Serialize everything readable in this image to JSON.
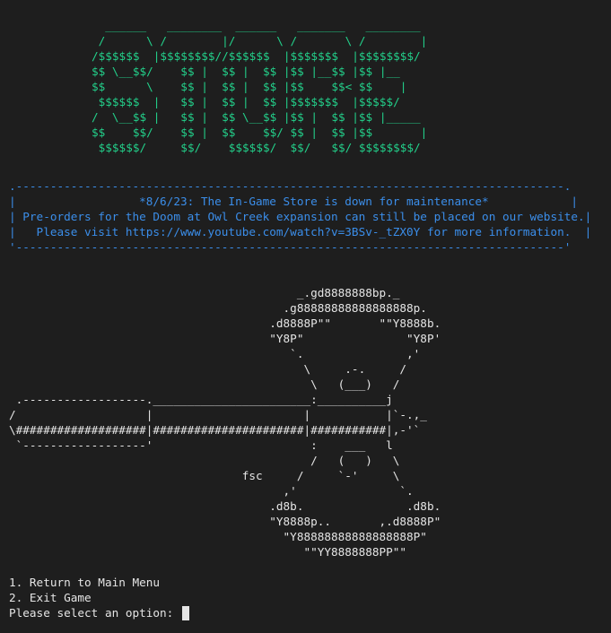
{
  "logo": {
    "lines": [
      "  ______   ________  ______   _______   ________",
      " /      \\ /        |/      \\ /       \\ /        |",
      "/$$$$$$  |$$$$$$$$//$$$$$$  |$$$$$$$  |$$$$$$$$/",
      "$$ \\__$$/    $$ |  $$ |  $$ |$$ |__$$ |$$ |__",
      "$$      \\    $$ |  $$ |  $$ |$$    $$< $$    |",
      " $$$$$$  |   $$ |  $$ |  $$ |$$$$$$$  |$$$$$/",
      "/  \\__$$ |   $$ |  $$ \\__$$ |$$ |  $$ |$$ |_____",
      "$$    $$/    $$ |  $$    $$/ $$ |  $$ |$$       |",
      " $$$$$$/     $$/    $$$$$$/  $$/   $$/ $$$$$$$$/"
    ]
  },
  "notice": {
    "top_border": ".--------------------------------------------------------------------------------.",
    "line1": "|                  *8/6/23: The In-Game Store is down for maintenance*            |",
    "line2": "| Pre-orders for the Doom at Owl Creek expansion can still be placed on our website.|",
    "line3": "|   Please visit https://www.youtube.com/watch?v=3BSv-_tZX0Y for more information.  |",
    "bottom_border": "'--------------------------------------------------------------------------------'"
  },
  "art": {
    "lines": [
      "                                          _.gd8888888bp._",
      "                                        .g88888888888888888p.",
      "                                      .d8888P\"\"       \"\"Y8888b.",
      "                                      \"Y8P\"               \"Y8P'",
      "                                         `.               ,'",
      "                                           \\     .-.     /",
      "                                            \\   (___)   /",
      " .------------------._______________________:__________j",
      "/                   |                      |           |`-.,_",
      "\\###################|######################|###########|,-'`",
      " `------------------'                       :    ___   l",
      "                                            /   (   )   \\",
      "                                  fsc     /     `-'     \\",
      "                                        ,'               `.",
      "                                      .d8b.               .d8b.",
      "                                      \"Y8888p..       ,.d8888P\"",
      "                                        \"Y88888888888888888P\"",
      "                                           \"\"YY8888888PP\"\""
    ]
  },
  "menu": {
    "option1": "1. Return to Main Menu",
    "option2": "2. Exit Game",
    "prompt": "Please select an option: "
  }
}
